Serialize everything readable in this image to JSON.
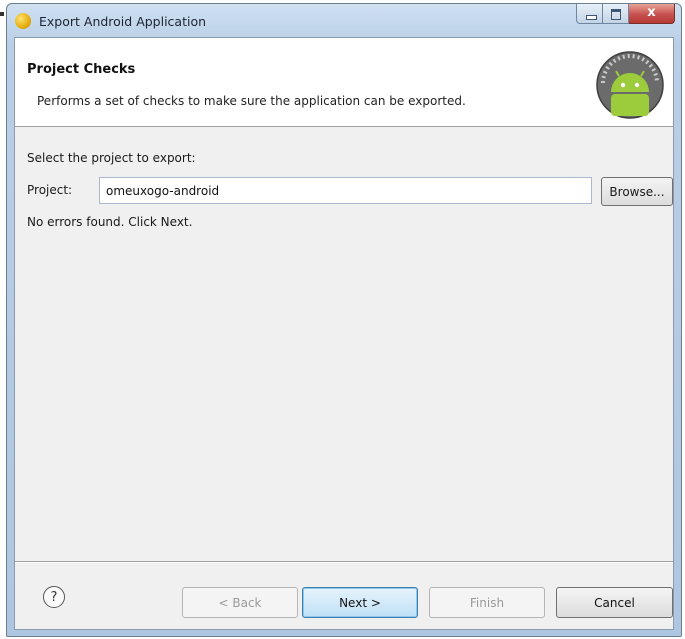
{
  "window": {
    "title": "Export Android Application",
    "controls": {
      "minimize": "minimize",
      "maximize": "maximize",
      "close": "x"
    }
  },
  "header": {
    "title": "Project Checks",
    "description": "Performs a set of checks to make sure the application can be exported.",
    "icon": "android-icon"
  },
  "form": {
    "section_label": "Select the project to export:",
    "project_label": "Project:",
    "project_value": "omeuxogo-android",
    "browse_label": "Browse...",
    "status": "No errors found. Click Next."
  },
  "footer": {
    "help_label": "?",
    "back_label": "< Back",
    "next_label": "Next >",
    "finish_label": "Finish",
    "cancel_label": "Cancel"
  },
  "colors": {
    "accent": "#3c7fb1",
    "close": "#c75050",
    "android_green": "#8bc34a"
  }
}
